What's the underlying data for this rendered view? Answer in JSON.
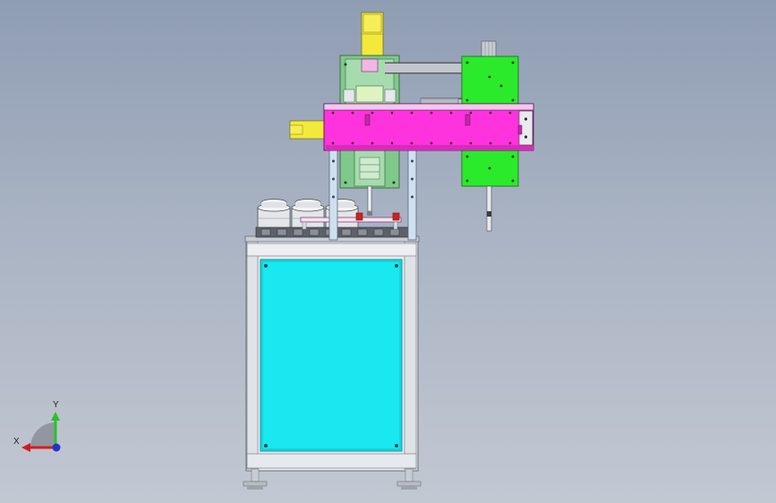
{
  "colors": {
    "background_top": "#8f9db3",
    "background_bottom": "#c2c8d2",
    "cabinet_panel": "#19e8f0",
    "carriage_beam": "#ff33dd",
    "motor_block": "#2bea2b",
    "mount_plate": "#7fc98a",
    "cylinder": "#f2e93a",
    "frame_metal": "#d9dde2",
    "axis_x": "#d41c1c",
    "axis_y": "#27c227",
    "axis_z": "#2233cc"
  },
  "triad": {
    "x_label": "X",
    "y_label": "Y"
  }
}
